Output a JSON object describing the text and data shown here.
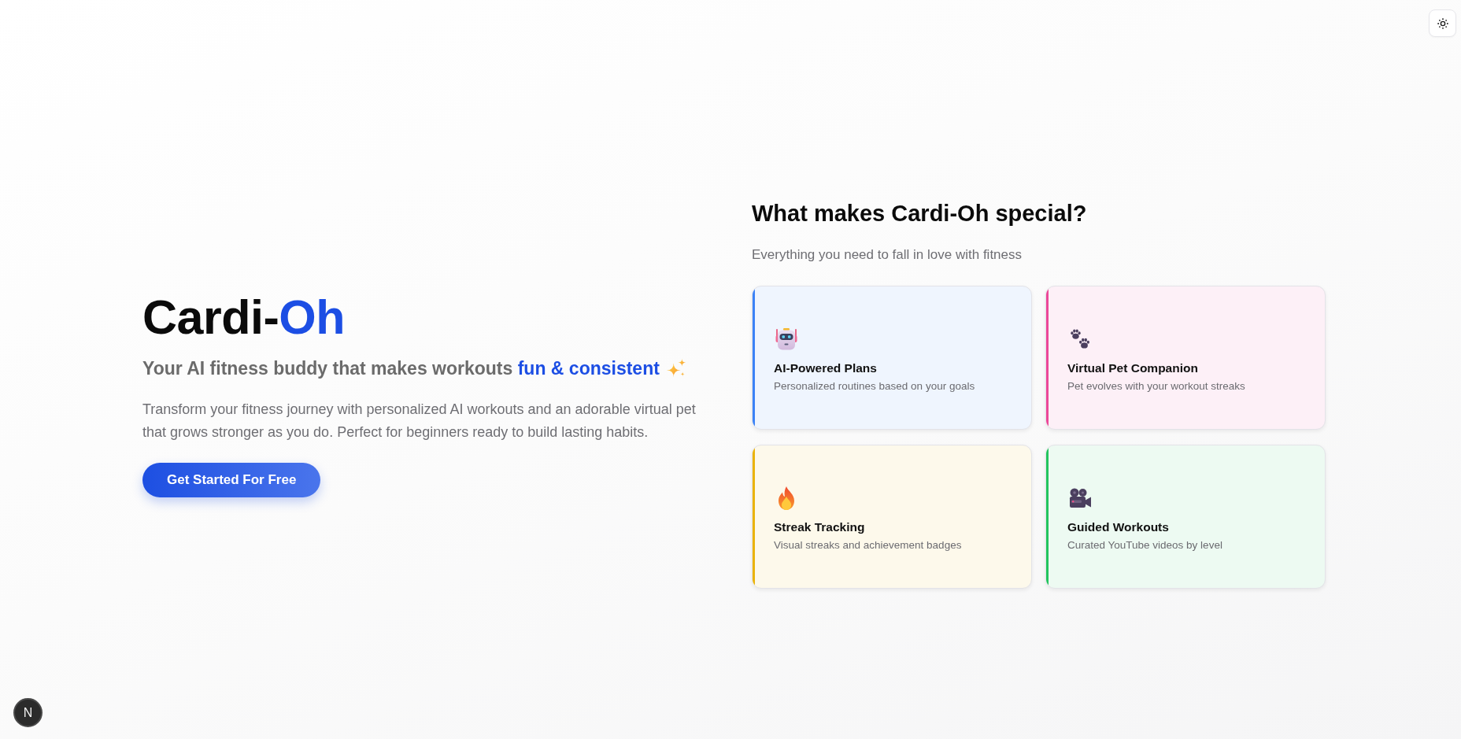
{
  "hero": {
    "title": "Cardi-**Oh**",
    "tagline": "Your AI fitness buddy that makes workouts **fun & consistent**",
    "description": "Transform your fitness journey with personalized AI workouts and an adorable virtual pet that grows stronger as you do. Perfect for beginners ready to build lasting habits.",
    "cta_button": "Get Started For Free"
  },
  "features": {
    "heading": "What makes Cardi-Oh special?",
    "subheading": "Everything you need to fall in love with fitness",
    "cards": [
      {
        "title": "AI-Powered Plans",
        "description": "Personalized routines based on your goals",
        "color": "#3b82f6"
      },
      {
        "title": "Virtual Pet Companion",
        "description": "Pet evolves with your workout streaks",
        "color": "#ec4899"
      },
      {
        "title": "Streak Tracking",
        "description": "Visual streaks and achievement badges",
        "color": "#eab308"
      },
      {
        "title": "Guided Workouts",
        "description": "Curated YouTube videos by level",
        "color": "#22c55e"
      }
    ]
  },
  "dev_indicator": {
    "label": "N"
  }
}
